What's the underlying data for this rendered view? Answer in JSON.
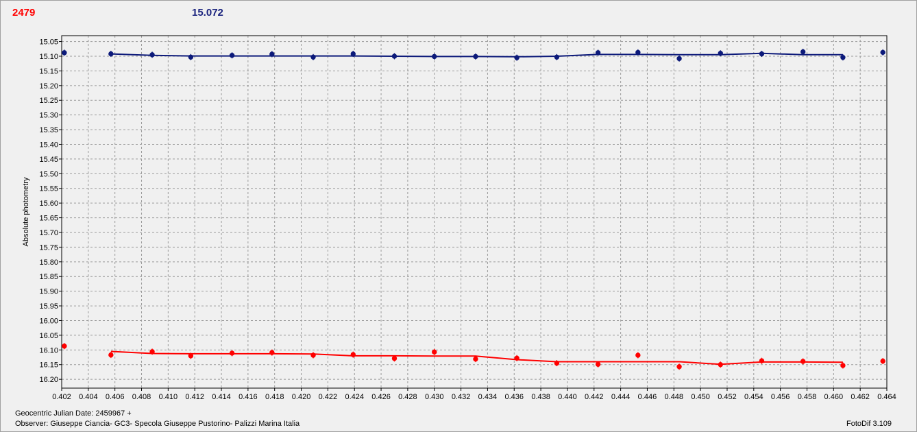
{
  "header": {
    "left_value": "2479",
    "right_value": "15.072"
  },
  "footer": {
    "date_label": "Geocentric Julian Date: 2459967 +",
    "observer": "Observer: Giuseppe Ciancia- GC3- Specola Giuseppe Pustorino- Palizzi Marina Italia",
    "software": "FotoDif 3.109"
  },
  "colors": {
    "blue": "#0d1a7a",
    "red": "#ff0000",
    "grid": "#9a9a9a",
    "plot_bg": "#f0f0f0"
  },
  "chart_data": {
    "type": "scatter",
    "ylabel": "Absolute photometry",
    "xlabel": "",
    "xlim": [
      0.402,
      0.464
    ],
    "ylim": [
      15.03,
      16.23
    ],
    "y_inverted": true,
    "grid": true,
    "x_ticks": [
      "0.402",
      "0.404",
      "0.406",
      "0.408",
      "0.410",
      "0.412",
      "0.414",
      "0.416",
      "0.418",
      "0.420",
      "0.422",
      "0.424",
      "0.426",
      "0.428",
      "0.430",
      "0.432",
      "0.434",
      "0.436",
      "0.438",
      "0.440",
      "0.442",
      "0.444",
      "0.446",
      "0.448",
      "0.450",
      "0.452",
      "0.454",
      "0.456",
      "0.458",
      "0.460",
      "0.462",
      "0.464"
    ],
    "y_ticks": [
      "15.05",
      "15.10",
      "15.15",
      "15.20",
      "15.25",
      "15.30",
      "15.35",
      "15.40",
      "15.45",
      "15.50",
      "15.55",
      "15.60",
      "15.65",
      "15.70",
      "15.75",
      "15.80",
      "15.85",
      "15.90",
      "15.95",
      "16.00",
      "16.05",
      "16.10",
      "16.15",
      "16.20"
    ],
    "series": [
      {
        "color": "#0d1a7a",
        "points": [
          [
            0.4022,
            15.088
          ],
          [
            0.4057,
            15.092
          ],
          [
            0.4088,
            15.095
          ],
          [
            0.4117,
            15.103
          ],
          [
            0.4148,
            15.097
          ],
          [
            0.4178,
            15.093
          ],
          [
            0.4209,
            15.103
          ],
          [
            0.4239,
            15.092
          ],
          [
            0.427,
            15.1
          ],
          [
            0.43,
            15.101
          ],
          [
            0.4331,
            15.101
          ],
          [
            0.4362,
            15.105
          ],
          [
            0.4392,
            15.103
          ],
          [
            0.4423,
            15.088
          ],
          [
            0.4453,
            15.087
          ],
          [
            0.4484,
            15.108
          ],
          [
            0.4515,
            15.09
          ],
          [
            0.4546,
            15.092
          ],
          [
            0.4577,
            15.085
          ],
          [
            0.4607,
            15.104
          ],
          [
            0.4637,
            15.087
          ]
        ],
        "smooth": [
          [
            0.4057,
            15.092
          ],
          [
            0.4088,
            15.097
          ],
          [
            0.4117,
            15.099
          ],
          [
            0.4148,
            15.099
          ],
          [
            0.4178,
            15.099
          ],
          [
            0.4209,
            15.099
          ],
          [
            0.4239,
            15.099
          ],
          [
            0.427,
            15.1
          ],
          [
            0.43,
            15.101
          ],
          [
            0.4331,
            15.101
          ],
          [
            0.4362,
            15.102
          ],
          [
            0.4392,
            15.1
          ],
          [
            0.4423,
            15.094
          ],
          [
            0.4453,
            15.094
          ],
          [
            0.4484,
            15.095
          ],
          [
            0.4515,
            15.095
          ],
          [
            0.4546,
            15.09
          ],
          [
            0.4577,
            15.095
          ],
          [
            0.4607,
            15.095
          ]
        ]
      },
      {
        "color": "#ff0000",
        "points": [
          [
            0.4022,
            16.087
          ],
          [
            0.4057,
            16.117
          ],
          [
            0.4088,
            16.106
          ],
          [
            0.4117,
            16.12
          ],
          [
            0.4148,
            16.111
          ],
          [
            0.4178,
            16.109
          ],
          [
            0.4209,
            16.118
          ],
          [
            0.4239,
            16.116
          ],
          [
            0.427,
            16.129
          ],
          [
            0.43,
            16.107
          ],
          [
            0.4331,
            16.131
          ],
          [
            0.4362,
            16.128
          ],
          [
            0.4392,
            16.145
          ],
          [
            0.4423,
            16.149
          ],
          [
            0.4453,
            16.118
          ],
          [
            0.4484,
            16.157
          ],
          [
            0.4515,
            16.15
          ],
          [
            0.4546,
            16.137
          ],
          [
            0.4577,
            16.139
          ],
          [
            0.4607,
            16.153
          ],
          [
            0.4637,
            16.138
          ]
        ],
        "smooth": [
          [
            0.4057,
            16.105
          ],
          [
            0.4088,
            16.112
          ],
          [
            0.4117,
            16.113
          ],
          [
            0.4148,
            16.113
          ],
          [
            0.4178,
            16.113
          ],
          [
            0.4209,
            16.114
          ],
          [
            0.4239,
            16.12
          ],
          [
            0.427,
            16.12
          ],
          [
            0.43,
            16.121
          ],
          [
            0.4331,
            16.121
          ],
          [
            0.4362,
            16.133
          ],
          [
            0.4392,
            16.14
          ],
          [
            0.4423,
            16.14
          ],
          [
            0.4453,
            16.14
          ],
          [
            0.4484,
            16.14
          ],
          [
            0.4515,
            16.149
          ],
          [
            0.4546,
            16.141
          ],
          [
            0.4577,
            16.141
          ],
          [
            0.4607,
            16.142
          ]
        ]
      }
    ]
  }
}
